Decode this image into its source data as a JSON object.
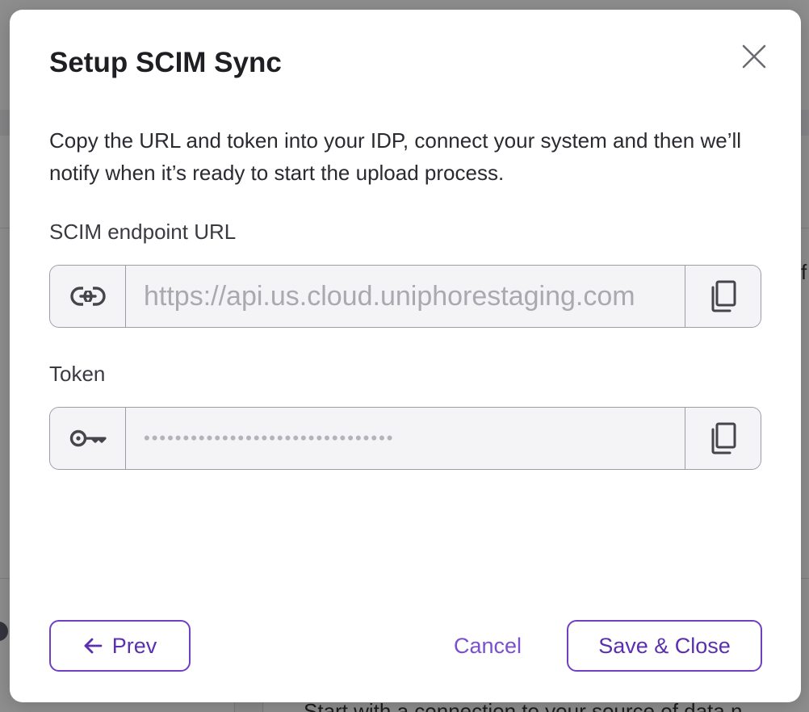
{
  "background": {
    "partial_text_right": "f",
    "footer_text": "Start with a connection to your source of data n"
  },
  "modal": {
    "title": "Setup SCIM Sync",
    "description": "Copy the URL and token into your IDP, connect your system and then we’ll notify when it’s ready to start the upload process.",
    "fields": {
      "endpoint": {
        "label": "SCIM endpoint URL",
        "value": "https://api.us.cloud.uniphorestaging.com",
        "prefix_icon": "link-icon",
        "suffix_icon": "copy-icon"
      },
      "token": {
        "label": "Token",
        "value": "••••••••••••••••••••••••••••••••",
        "prefix_icon": "key-icon",
        "suffix_icon": "copy-icon"
      }
    },
    "buttons": {
      "prev": "Prev",
      "cancel": "Cancel",
      "save": "Save & Close"
    }
  },
  "colors": {
    "accent": "#6f3fc4",
    "accent_text": "#5a2fb0",
    "title_text": "#1f1f23",
    "field_bg": "#f4f4f6",
    "field_border": "#9c9ca6"
  }
}
